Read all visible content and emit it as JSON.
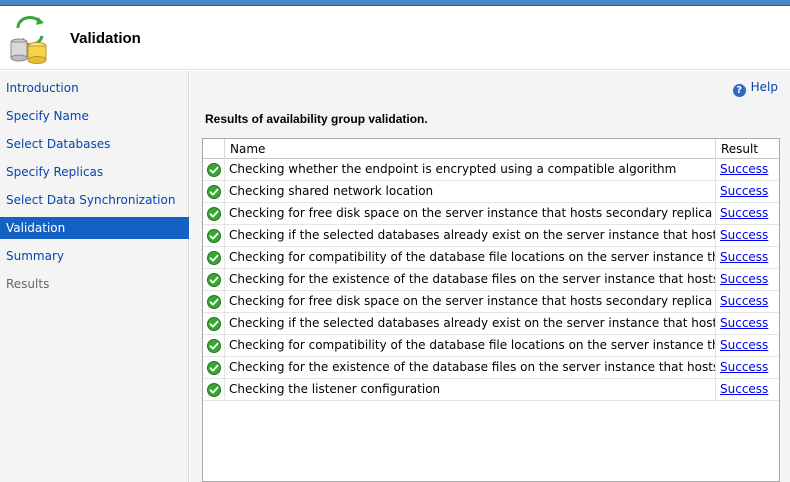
{
  "header": {
    "title": "Validation",
    "icon": "database-sync-icon"
  },
  "sidebar": {
    "items": [
      {
        "label": "Introduction",
        "state": "link"
      },
      {
        "label": "Specify Name",
        "state": "link"
      },
      {
        "label": "Select Databases",
        "state": "link"
      },
      {
        "label": "Specify Replicas",
        "state": "link"
      },
      {
        "label": "Select Data Synchronization",
        "state": "link"
      },
      {
        "label": "Validation",
        "state": "active"
      },
      {
        "label": "Summary",
        "state": "link"
      },
      {
        "label": "Results",
        "state": "disabled"
      }
    ]
  },
  "help": {
    "label": "Help",
    "icon": "help-icon"
  },
  "results_heading": "Results of availability group validation.",
  "table": {
    "columns": [
      "Name",
      "Result"
    ],
    "rows": [
      {
        "name": "Checking whether the endpoint is encrypted using a compatible algorithm",
        "result": "Success",
        "icon": "success-check-icon"
      },
      {
        "name": "Checking shared network location",
        "result": "Success",
        "icon": "success-check-icon"
      },
      {
        "name": "Checking for free disk space on the server instance that hosts secondary replica ALWAYSO...",
        "result": "Success",
        "icon": "success-check-icon"
      },
      {
        "name": "Checking if the selected databases already exist on the server instance that hosts secondar...",
        "result": "Success",
        "icon": "success-check-icon"
      },
      {
        "name": "Checking for compatibility of the database file locations on the server instance that hosts ...",
        "result": "Success",
        "icon": "success-check-icon"
      },
      {
        "name": "Checking for the existence of the database files on the server instance that hosts secondar...",
        "result": "Success",
        "icon": "success-check-icon"
      },
      {
        "name": "Checking for free disk space on the server instance that hosts secondary replica ALWAYSO...",
        "result": "Success",
        "icon": "success-check-icon"
      },
      {
        "name": "Checking if the selected databases already exist on the server instance that hosts secondar...",
        "result": "Success",
        "icon": "success-check-icon"
      },
      {
        "name": "Checking for compatibility of the database file locations on the server instance that hosts ...",
        "result": "Success",
        "icon": "success-check-icon"
      },
      {
        "name": "Checking for the existence of the database files on the server instance that hosts secondar...",
        "result": "Success",
        "icon": "success-check-icon"
      },
      {
        "name": "Checking the listener configuration",
        "result": "Success",
        "icon": "success-check-icon"
      }
    ]
  },
  "colors": {
    "accent": "#1361c2",
    "link": "#0645ad",
    "success": "#3aa635"
  }
}
